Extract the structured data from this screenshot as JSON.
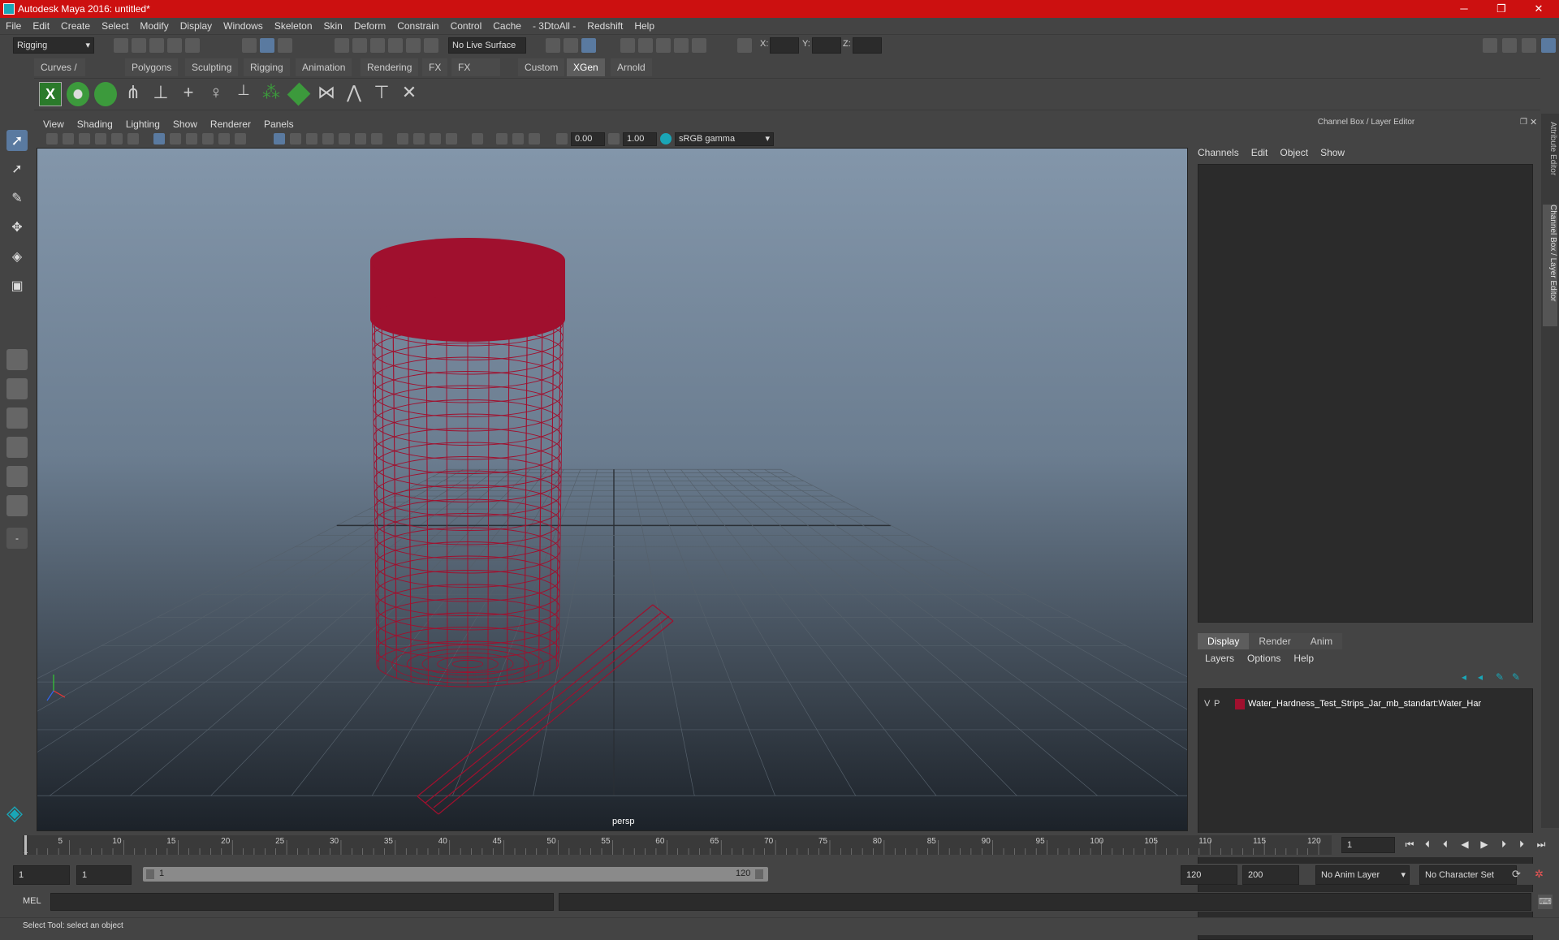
{
  "window": {
    "title": "Autodesk Maya 2016: untitled*",
    "minimize": "─",
    "maximize": "❐",
    "close": "✕"
  },
  "menus": [
    "File",
    "Edit",
    "Create",
    "Select",
    "Modify",
    "Display",
    "Windows",
    "Skeleton",
    "Skin",
    "Deform",
    "Constrain",
    "Control",
    "Cache",
    "- 3DtoAll -",
    "Redshift",
    "Help"
  ],
  "toolbar": {
    "mode": "Rigging",
    "live_surface": "No Live Surface",
    "x_label": "X:",
    "y_label": "Y:",
    "z_label": "Z:"
  },
  "shelf_tabs": [
    "Curves / Surfaces",
    "Polygons",
    "Sculpting",
    "Rigging",
    "Animation",
    "Rendering",
    "FX",
    "FX Caching",
    "Custom",
    "XGen",
    "Arnold"
  ],
  "shelf_active_tab": "XGen",
  "viewport": {
    "menus": [
      "View",
      "Shading",
      "Lighting",
      "Show",
      "Renderer",
      "Panels"
    ],
    "exposure": "0.00",
    "gamma": "1.00",
    "colorspace": "sRGB gamma",
    "camera_label": "persp"
  },
  "channel_box": {
    "title": "Channel Box / Layer Editor",
    "menus": [
      "Channels",
      "Edit",
      "Object",
      "Show"
    ]
  },
  "layer_editor": {
    "tabs": [
      "Display",
      "Render",
      "Anim"
    ],
    "active_tab": "Display",
    "menus": [
      "Layers",
      "Options",
      "Help"
    ],
    "layers": [
      {
        "v": "V",
        "p": "P",
        "name": "Water_Hardness_Test_Strips_Jar_mb_standart:Water_Har",
        "color": "#a0102e"
      }
    ]
  },
  "side_tabs": [
    "Attribute Editor",
    "Channel Box / Layer Editor"
  ],
  "timeline": {
    "ticks": [
      "5",
      "10",
      "15",
      "20",
      "25",
      "30",
      "35",
      "40",
      "45",
      "50",
      "55",
      "60",
      "65",
      "70",
      "75",
      "80",
      "85",
      "90",
      "95",
      "100",
      "105",
      "110",
      "115",
      "120"
    ],
    "start_tick": "1",
    "current_frame": "1"
  },
  "range": {
    "start": "1",
    "anim_start": "1",
    "slider_start": "1",
    "slider_end": "120",
    "end": "120",
    "anim_end": "200",
    "anim_layer": "No Anim Layer",
    "character_set": "No Character Set"
  },
  "command_line": {
    "label": "MEL"
  },
  "status": "Select Tool: select an object",
  "colors": {
    "wire": "#a0102e",
    "title_bar": "#cc1010",
    "accent": "#1aa6b7"
  }
}
